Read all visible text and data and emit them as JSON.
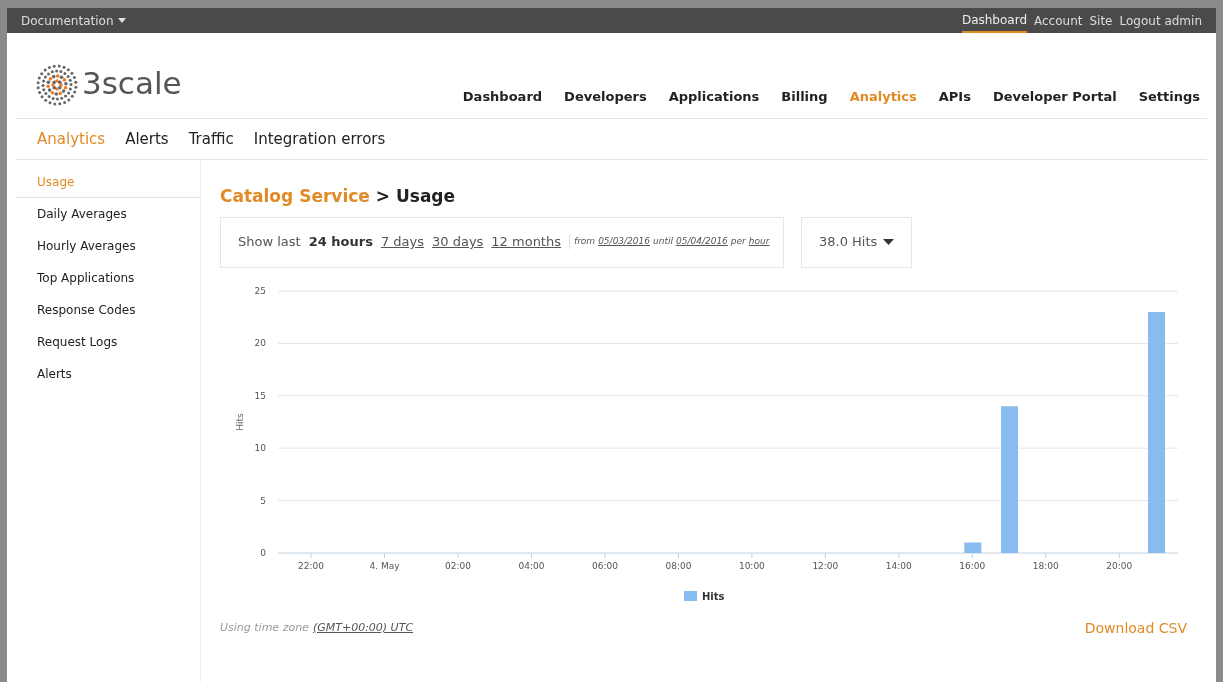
{
  "top_bar": {
    "menu": "Documentation",
    "links": [
      {
        "label": "Dashboard",
        "selected": true
      },
      {
        "label": "Account",
        "selected": false
      },
      {
        "label": "Site",
        "selected": false
      },
      {
        "label": "Logout admin",
        "selected": false
      }
    ]
  },
  "logo": {
    "text": "3scale"
  },
  "main_nav": [
    {
      "label": "Dashboard",
      "selected": false
    },
    {
      "label": "Developers",
      "selected": false
    },
    {
      "label": "Applications",
      "selected": false
    },
    {
      "label": "Billing",
      "selected": false
    },
    {
      "label": "Analytics",
      "selected": true
    },
    {
      "label": "APIs",
      "selected": false
    },
    {
      "label": "Developer Portal",
      "selected": false
    },
    {
      "label": "Settings",
      "selected": false
    }
  ],
  "sub_nav": [
    {
      "label": "Analytics",
      "selected": true
    },
    {
      "label": "Alerts",
      "selected": false
    },
    {
      "label": "Traffic",
      "selected": false
    },
    {
      "label": "Integration errors",
      "selected": false
    }
  ],
  "sidebar": {
    "items": [
      {
        "label": "Usage",
        "selected": true
      },
      {
        "label": "Daily Averages",
        "selected": false
      },
      {
        "label": "Hourly Averages",
        "selected": false
      },
      {
        "label": "Top Applications",
        "selected": false
      },
      {
        "label": "Response Codes",
        "selected": false
      },
      {
        "label": "Request Logs",
        "selected": false
      },
      {
        "label": "Alerts",
        "selected": false
      }
    ]
  },
  "heading": {
    "service": "Catalog Service",
    "page": "> Usage"
  },
  "period": {
    "prefix": "Show last",
    "options": [
      {
        "label": "24 hours",
        "selected": true
      },
      {
        "label": "7 days",
        "selected": false
      },
      {
        "label": "30 days",
        "selected": false
      },
      {
        "label": "12 months",
        "selected": false
      }
    ],
    "from_label": "from",
    "from": "05/03/2016",
    "until_label": "until",
    "until": "05/04/2016",
    "per_label": "per",
    "per": "hour"
  },
  "metric_dropdown": {
    "value": "38.0 Hits"
  },
  "chart": {
    "chart_data": {
      "type": "bar",
      "ylabel": "Hits",
      "grid": true,
      "categories": [
        "22:00",
        null,
        "4. May",
        null,
        "02:00",
        null,
        "04:00",
        null,
        "06:00",
        null,
        "08:00",
        null,
        "10:00",
        null,
        "12:00",
        null,
        "14:00",
        null,
        "16:00",
        null,
        "18:00",
        null,
        "20:00",
        null
      ],
      "series": [
        {
          "name": "Hits",
          "color": "#88bbee",
          "values": [
            0,
            0,
            0,
            0,
            0,
            0,
            0,
            0,
            0,
            0,
            0,
            0,
            0,
            0,
            0,
            0,
            0,
            0,
            1,
            14,
            0,
            0,
            0,
            23
          ]
        }
      ],
      "ylim": [
        0,
        25
      ],
      "yticks": [
        0,
        5,
        10,
        15,
        20,
        25
      ]
    }
  },
  "footer": {
    "timezone_label": "Using time zone",
    "timezone": "(GMT+00:00) UTC",
    "download": "Download CSV"
  }
}
